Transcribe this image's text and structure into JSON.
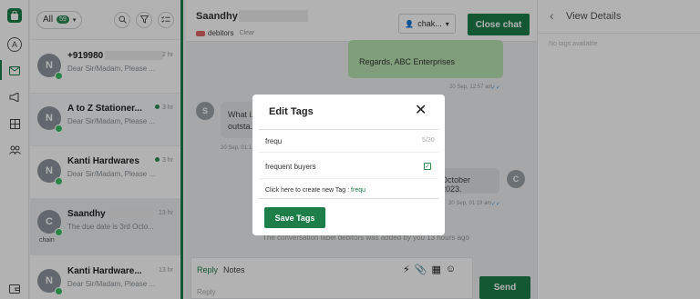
{
  "rail": {
    "logo_icon": "shopping-bag-icon",
    "avatar_letter": "A",
    "icons": [
      "chat-icon",
      "megaphone-icon",
      "grid-icon",
      "contacts-icon",
      "wallet-icon"
    ]
  },
  "chatlist": {
    "filter_label": "All",
    "filter_count": "59",
    "items": [
      {
        "avatar": "N",
        "name": "+919980",
        "preview": "Dear Sir/Madam, Please ...",
        "time": "2 hr",
        "unread": false
      },
      {
        "avatar": "N",
        "name": "A to Z Stationer...",
        "preview": "Dear Sir/Madam, Please ...",
        "time": "3 hr",
        "unread": true
      },
      {
        "avatar": "N",
        "name": "Kanti Hardwares",
        "preview": "Dear Sir/Madam, Please ...",
        "time": "3 hr",
        "unread": true
      },
      {
        "avatar": "C",
        "name": "Saandhy",
        "preview": "The due date is 3rd Octo...",
        "time": "13 hr",
        "unread": false,
        "label": "chain"
      },
      {
        "avatar": "N",
        "name": "Kanti Hardware...",
        "preview": "Dear Sir/Madam, Please ...",
        "time": "13 hr",
        "unread": false
      }
    ]
  },
  "main": {
    "contact_name": "Saandhy",
    "tag_name": "debitors",
    "tag_clear": "Clear",
    "agent_label": "chak...",
    "close_chat": "Close chat",
    "bubble_out_text": "Regards, ABC Enterprises",
    "stamp1": "20 Sep, 12:57 am",
    "bubble_in_text": "What i... outsta...",
    "stamp2": "20 Sep, 01:1...",
    "bubble_out2_text": "October 2023.",
    "stamp3": "20 Sep, 01:19 am",
    "system_line": "The conversation label debitors was added by you 13 hours ago",
    "reply_tab": "Reply",
    "notes_tab": "Notes",
    "reply_placeholder": "Reply",
    "send": "Send"
  },
  "right_panel": {
    "title": "View Details",
    "no_tags": "No tags available"
  },
  "modal": {
    "title": "Edit Tags",
    "input_value": "frequ",
    "char_count": "5/30",
    "option": "frequent buyers",
    "create_text": "Click here to create new Tag :",
    "create_query": "frequ",
    "save": "Save Tags"
  },
  "colors": {
    "brand_green": "#1e7e4a",
    "out_bubble": "#b9e3b2",
    "tag_red": "#e06666"
  }
}
